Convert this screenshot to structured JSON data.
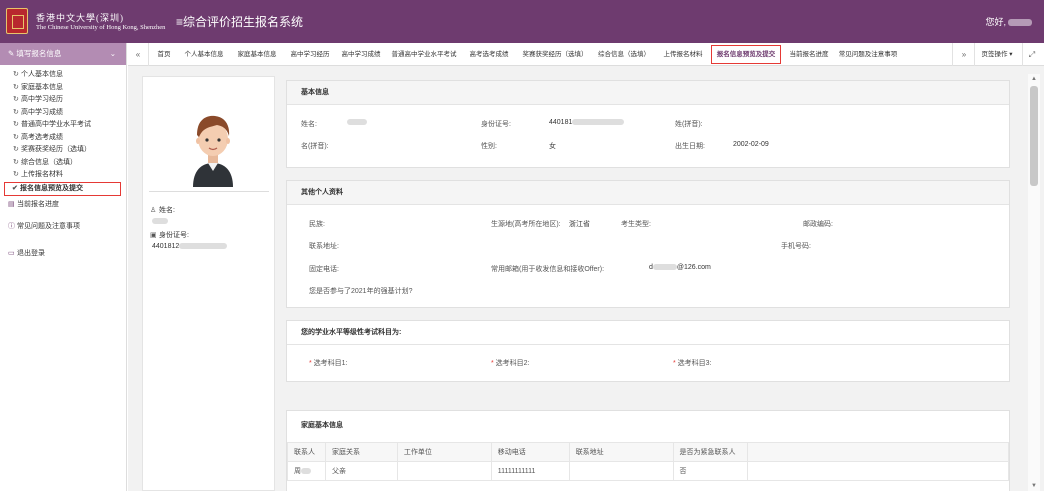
{
  "header": {
    "uni_cn": "香港中文大學(深圳)",
    "uni_en": "The Chinese University of Hong Kong, Shenzhen",
    "menu_icon": "≡",
    "title": "综合评价招生报名系统",
    "greeting": "您好,"
  },
  "sidebar": {
    "section_title": "填写报名信息",
    "items": [
      {
        "label": "个人基本信息"
      },
      {
        "label": "家庭基本信息"
      },
      {
        "label": "高中学习经历"
      },
      {
        "label": "高中学习成绩"
      },
      {
        "label": "普通高中学业水平考试"
      },
      {
        "label": "高考选考成绩"
      },
      {
        "label": "奖赛获奖经历（选填）"
      },
      {
        "label": "综合信息（选填）"
      },
      {
        "label": "上传报名材料"
      },
      {
        "label": "报名信息预览及提交"
      }
    ],
    "progress": "当前报名进度",
    "faq": "常见问题及注意事项",
    "logout": "退出登录"
  },
  "tabs": {
    "items": [
      "首页",
      "个人基本信息",
      "家庭基本信息",
      "高中学习经历",
      "高中学习成绩",
      "普通高中学业水平考试",
      "高考选考成绩",
      "奖赛获奖经历（选填）",
      "综合信息（选填）",
      "上传报名材料",
      "报名信息预览及提交",
      "当前报名进度",
      "常见问题及注意事项"
    ],
    "page_ops": "页签操作"
  },
  "profile": {
    "name_label": "姓名:",
    "id_label": "身份证号:",
    "id_value": "4401812"
  },
  "basic": {
    "title": "基本信息",
    "name_label": "姓名:",
    "id_label": "身份证号:",
    "id_value": "440181",
    "surname_py_label": "姓(拼音):",
    "given_py_label": "名(拼音):",
    "gender_label": "性别:",
    "gender_value": "女",
    "dob_label": "出生日期:",
    "dob_value": "2002-02-09"
  },
  "other": {
    "title": "其他个人资料",
    "ethnic_label": "民族:",
    "origin_label": "生源地(高考所在地区):",
    "origin_value": "浙江省",
    "candidate_type_label": "考生类型:",
    "postal_label": "邮政编码:",
    "address_label": "联系地址:",
    "mobile_label": "手机号码:",
    "phone_label": "固定电话:",
    "email_label": "常用邮箱(用于收发信息和接收Offer):",
    "email_prefix": "d",
    "email_suffix": "@126.com",
    "plan_question": "您是否参与了2021年的强基计划?"
  },
  "subjects": {
    "title": "您的学业水平等级性考试科目为:",
    "s1": "选考科目1:",
    "s2": "选考科目2:",
    "s3": "选考科目3:"
  },
  "family": {
    "title": "家庭基本信息",
    "headers": [
      "联系人",
      "家庭关系",
      "工作单位",
      "移动电话",
      "联系地址",
      "是否为紧急联系人",
      ""
    ],
    "rows": [
      [
        "周",
        "父亲",
        "",
        "11111111111",
        "",
        "否",
        ""
      ]
    ]
  }
}
